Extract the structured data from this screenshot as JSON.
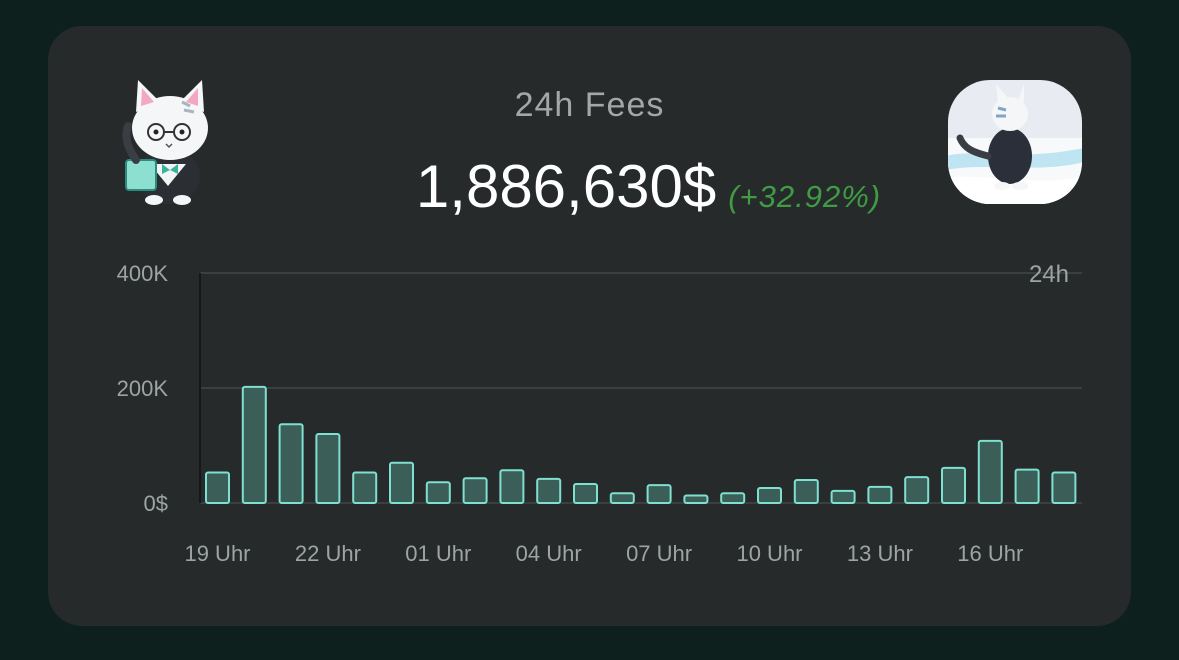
{
  "header": {
    "title": "24h Fees",
    "total": "1,886,630$",
    "change": "(+32.92%)",
    "period": "24h"
  },
  "colors": {
    "background": "#0d201e",
    "card": "#262a2a",
    "bar_fill": "#3c5e58",
    "bar_stroke": "#7ee0d0",
    "change_positive": "#3f9c45"
  },
  "icons": {
    "left": "cat-mascot-with-glasses-icon",
    "right": "cat-mascot-in-snow-icon"
  },
  "chart_data": {
    "type": "bar",
    "title": "24h Fees",
    "xlabel": "",
    "ylabel": "",
    "ylim": [
      0,
      400000
    ],
    "y_ticks": [
      {
        "value": 0,
        "label": "0$"
      },
      {
        "value": 200000,
        "label": "200K"
      },
      {
        "value": 400000,
        "label": "400K"
      }
    ],
    "x_tick_labels": [
      "19 Uhr",
      "22 Uhr",
      "01 Uhr",
      "04 Uhr",
      "07 Uhr",
      "10 Uhr",
      "13 Uhr",
      "16 Uhr"
    ],
    "x_tick_every": 3,
    "categories": [
      "19 Uhr",
      "20 Uhr",
      "21 Uhr",
      "22 Uhr",
      "23 Uhr",
      "00 Uhr",
      "01 Uhr",
      "02 Uhr",
      "03 Uhr",
      "04 Uhr",
      "05 Uhr",
      "06 Uhr",
      "07 Uhr",
      "08 Uhr",
      "09 Uhr",
      "10 Uhr",
      "11 Uhr",
      "12 Uhr",
      "13 Uhr",
      "14 Uhr",
      "15 Uhr",
      "16 Uhr",
      "17 Uhr",
      "18 Uhr"
    ],
    "values": [
      53000,
      202000,
      137000,
      120000,
      53000,
      70000,
      36000,
      43000,
      57000,
      42000,
      33000,
      17000,
      31000,
      13000,
      17000,
      26000,
      40000,
      21000,
      28000,
      45000,
      61000,
      108000,
      58000,
      53000
    ],
    "grid": true,
    "legend": "none"
  }
}
